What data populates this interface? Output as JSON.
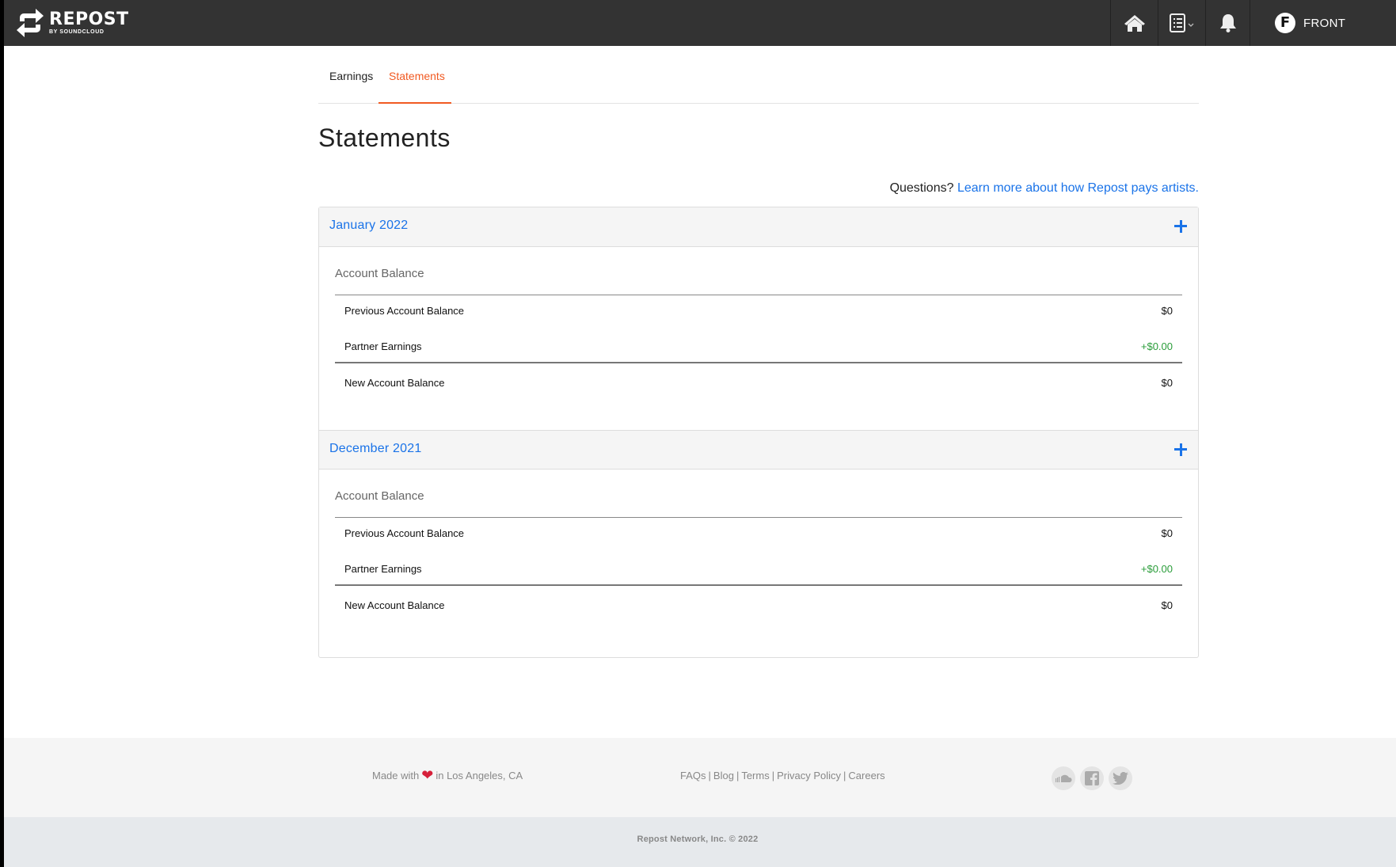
{
  "brand": {
    "name": "REPOST",
    "sub": "BY SOUNDCLOUD"
  },
  "nav": {
    "icons": [
      "home-icon",
      "checklist-icon",
      "bell-icon"
    ],
    "account": {
      "initial": "F",
      "name": "FRONT"
    }
  },
  "tabs": [
    {
      "label": "Earnings",
      "active": false
    },
    {
      "label": "Statements",
      "active": true
    }
  ],
  "page_title": "Statements",
  "questions": {
    "prefix": "Questions?",
    "link": "Learn more about how Repost pays artists."
  },
  "statements": [
    {
      "month": "January 2022",
      "section_label": "Account Balance",
      "rows": {
        "previous": {
          "label": "Previous Account Balance",
          "value": "$0"
        },
        "partner": {
          "label": "Partner Earnings",
          "value": "+$0.00"
        },
        "new": {
          "label": "New Account Balance",
          "value": "$0"
        }
      }
    },
    {
      "month": "December 2021",
      "section_label": "Account Balance",
      "rows": {
        "previous": {
          "label": "Previous Account Balance",
          "value": "$0"
        },
        "partner": {
          "label": "Partner Earnings",
          "value": "+$0.00"
        },
        "new": {
          "label": "New Account Balance",
          "value": "$0"
        }
      }
    }
  ],
  "footer": {
    "made_with": "Made with",
    "location": "in Los Angeles, CA",
    "links": [
      "FAQs",
      "Blog",
      "Terms",
      "Privacy Policy",
      "Careers"
    ],
    "socials": [
      "soundcloud-icon",
      "facebook-icon",
      "twitter-icon"
    ],
    "copyright": "Repost Network, Inc. © 2022"
  },
  "colors": {
    "accent": "#f15a22",
    "link": "#1a73e8",
    "positive": "#2a9d3a",
    "topbar": "#333333"
  }
}
